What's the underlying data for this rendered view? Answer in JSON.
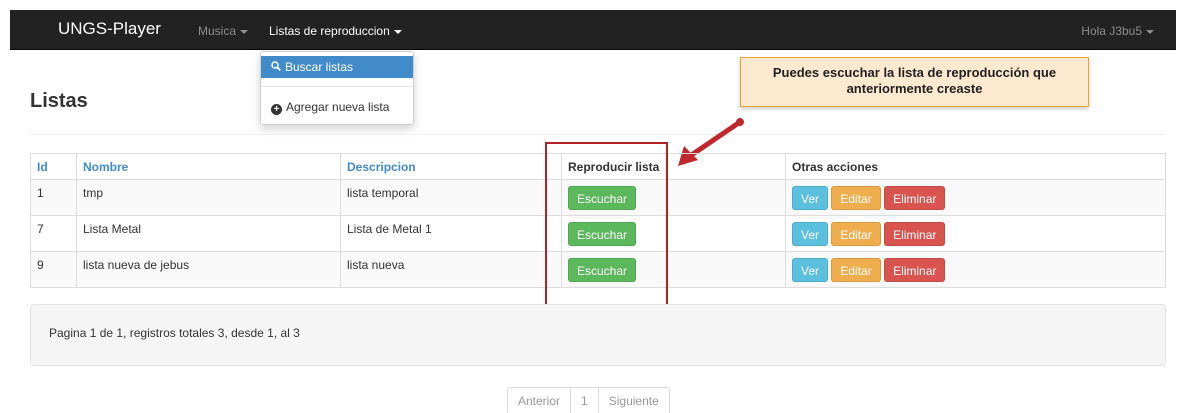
{
  "navbar": {
    "brand": "UNGS-Player",
    "musica": "Musica",
    "listas": "Listas de reproduccion",
    "user": "Hola J3bu5"
  },
  "dropdown": {
    "search": "Buscar listas",
    "add": "Agregar nueva lista"
  },
  "page": {
    "title": "Listas"
  },
  "callout": {
    "text": "Puedes escuchar la lista de reproducción que anteriormente creaste"
  },
  "table": {
    "headers": [
      "Id",
      "Nombre",
      "Descripcion",
      "Reproducir lista",
      "Otras acciones"
    ],
    "rows": [
      {
        "id": "1",
        "nombre": "tmp",
        "descripcion": "lista temporal"
      },
      {
        "id": "7",
        "nombre": "Lista Metal",
        "descripcion": "Lista de Metal 1"
      },
      {
        "id": "9",
        "nombre": "lista nueva de jebus",
        "descripcion": "lista nueva"
      }
    ],
    "play_label": "Escuchar",
    "ver_label": "Ver",
    "editar_label": "Editar",
    "eliminar_label": "Eliminar"
  },
  "summary": {
    "text": "Pagina 1 de 1, registros totales 3, desde 1, al 3"
  },
  "pager": {
    "prev": "Anterior",
    "page": "1",
    "next": "Siguiente"
  },
  "colors": {
    "primary": "#428bca",
    "success": "#5cb85c",
    "info": "#5bc0de",
    "warning": "#f0ad4e",
    "danger": "#d9534f",
    "highlight": "#b22222"
  }
}
